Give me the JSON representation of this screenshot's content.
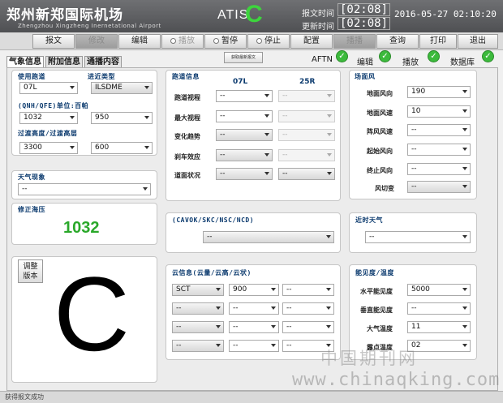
{
  "header": {
    "airport_cn": "郑州新郑国际机场",
    "airport_en": "Zhengzhou Xingzheng Inernetational Airport",
    "atis_label": "ATIS",
    "atis_code": "C",
    "report_time_label": "报文时间",
    "report_time": "[02:08]",
    "update_time_label": "更新时间",
    "update_time": "[02:08]",
    "datetime": "2016-05-27 02:10:20"
  },
  "toolbar": {
    "message": "报文",
    "modify": "修改",
    "edit": "编辑",
    "play": "播放",
    "pause": "暂停",
    "stop": "停止",
    "config": "配置",
    "broadcast": "播播",
    "query": "查询",
    "print": "打印",
    "exit": "退出"
  },
  "tabs": [
    "气象信息",
    "附加信息",
    "通播内容"
  ],
  "new_message_button": "获取最新报文",
  "status": {
    "aftn": "AFTN",
    "edit": "编辑",
    "play": "播放",
    "database": "数据库"
  },
  "left": {
    "runway_label": "使用跑道",
    "runway_value": "07L",
    "approach_label": "进近类型",
    "approach_value": "ILSDME",
    "qnh_label": "(QNH/QFE)单位:百帕",
    "qnh_value": "1032",
    "qfe_value": "950",
    "transition_label": "过渡高度/过渡高层",
    "transition_alt": "3300",
    "transition_level": "600",
    "weather_label": "天气现象",
    "weather_value": "--",
    "corrected_label": "修正海压",
    "corrected_value": "1032",
    "adjust_button_line1": "调整",
    "adjust_button_line2": "版本",
    "big_code": "C"
  },
  "runway_info": {
    "title": "跑道信息",
    "col_07l": "07L",
    "col_25r": "25R",
    "rows": [
      {
        "label": "跑道视程",
        "v07": "--",
        "v25": "--"
      },
      {
        "label": "最大视程",
        "v07": "--",
        "v25": "--"
      },
      {
        "label": "变化趋势",
        "v07": "--",
        "v25": "--"
      },
      {
        "label": "刹车效应",
        "v07": "--",
        "v25": "--"
      },
      {
        "label": "道面状况",
        "v07": "--",
        "v25": "--"
      }
    ]
  },
  "surface_wind": {
    "title": "场面风",
    "rows": [
      {
        "label": "地面风向",
        "value": "190"
      },
      {
        "label": "地面风速",
        "value": "10"
      },
      {
        "label": "阵风风速",
        "value": "--"
      },
      {
        "label": "起始风向",
        "value": "--"
      },
      {
        "label": "终止风向",
        "value": "--"
      },
      {
        "label": "风切变",
        "value": "--"
      }
    ]
  },
  "cavok": {
    "title": "(CAVOK/SKC/NSC/NCD)",
    "value": "--"
  },
  "recent_weather": {
    "title": "近时天气",
    "value": "--"
  },
  "cloud": {
    "title": "云信息(云量/云高/云状)",
    "rows": [
      {
        "amount": "SCT",
        "height": "900",
        "type": "--"
      },
      {
        "amount": "--",
        "height": "--",
        "type": "--"
      },
      {
        "amount": "--",
        "height": "--",
        "type": "--"
      },
      {
        "amount": "--",
        "height": "--",
        "type": "--"
      }
    ]
  },
  "visibility": {
    "title": "能见度/温度",
    "rows": [
      {
        "label": "水平能见度",
        "value": "5000"
      },
      {
        "label": "垂直能见度",
        "value": "--"
      },
      {
        "label": "大气温度",
        "value": "11"
      },
      {
        "label": "露点温度",
        "value": "02"
      }
    ]
  },
  "statusbar": {
    "text": "获得报文成功"
  },
  "watermark": {
    "cn": "中国期刊网",
    "url": "www.chinaqking.com"
  }
}
